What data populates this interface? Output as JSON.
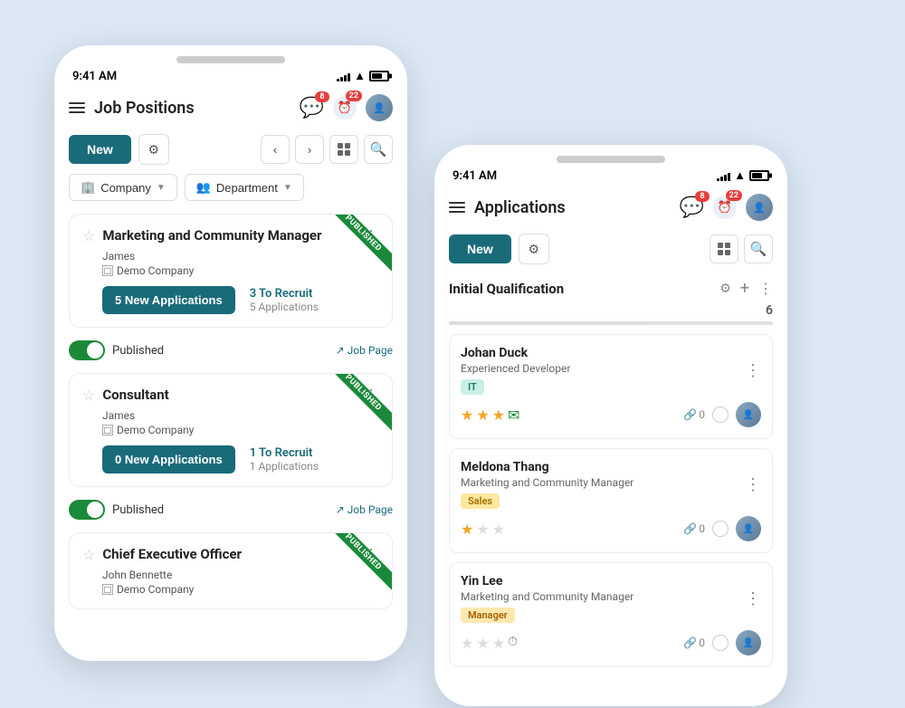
{
  "background_color": "#dce8f5",
  "phone1": {
    "status": {
      "time": "9:41 AM",
      "signal_bars": [
        3,
        5,
        7,
        9,
        11
      ],
      "battery_pct": 70
    },
    "nav": {
      "title": "Job Positions",
      "chat_badge": "8",
      "activity_badge": "22"
    },
    "toolbar": {
      "new_label": "New",
      "settings_label": "⚙"
    },
    "filters": {
      "company_label": "Company",
      "department_label": "Department"
    },
    "jobs": [
      {
        "title": "Marketing and Community Manager",
        "person": "James",
        "company": "Demo Company",
        "published": true,
        "ribbon": "PUBLISHED",
        "applications_btn": "5 New Applications",
        "recruit_count": "3 To Recruit",
        "recruit_sub": "5 Applications"
      },
      {
        "title": "Consultant",
        "person": "James",
        "company": "Demo Company",
        "published": true,
        "ribbon": "PUBLISHED",
        "applications_btn": "0 New Applications",
        "recruit_count": "1 To Recruit",
        "recruit_sub": "1 Applications"
      },
      {
        "title": "Chief Executive Officer",
        "person": "John Bennette",
        "company": "Demo Company",
        "published": true,
        "ribbon": "PUBLISHED",
        "applications_btn": "",
        "recruit_count": "",
        "recruit_sub": ""
      }
    ]
  },
  "phone2": {
    "status": {
      "time": "9:41 AM"
    },
    "nav": {
      "title": "Applications",
      "chat_badge": "8",
      "activity_badge": "22"
    },
    "toolbar": {
      "new_label": "New"
    },
    "kanban_col": {
      "title": "Initial Qualification",
      "count": "6"
    },
    "applications": [
      {
        "name": "Johan Duck",
        "position": "Experienced Developer",
        "tag": "IT",
        "tag_class": "tag-it",
        "stars_filled": 3,
        "stars_empty": 0,
        "show_email": true,
        "link_count": "0"
      },
      {
        "name": "Meldona Thang",
        "position": "Marketing and Community Manager",
        "tag": "Sales",
        "tag_class": "tag-sales",
        "stars_filled": 1,
        "stars_empty": 2,
        "show_email": false,
        "link_count": "0"
      },
      {
        "name": "Yin Lee",
        "position": "Marketing and Community Manager",
        "tag": "Manager",
        "tag_class": "tag-manager",
        "stars_filled": 0,
        "stars_empty": 3,
        "show_email": false,
        "link_count": "0",
        "show_clock": true
      }
    ]
  }
}
